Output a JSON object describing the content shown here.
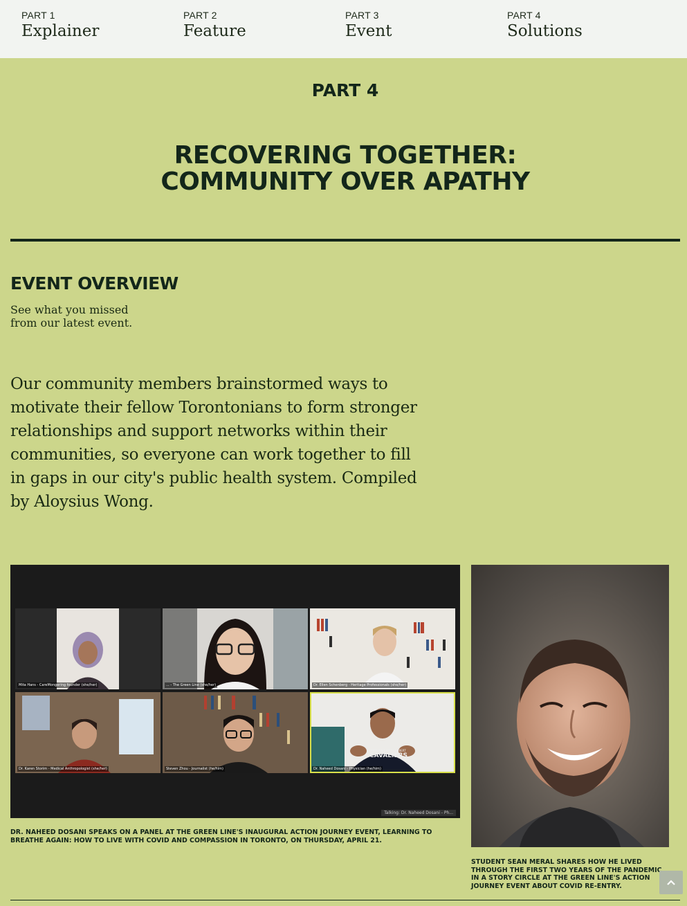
{
  "nav": {
    "items": [
      {
        "part": "PART 1",
        "title": "Explainer"
      },
      {
        "part": "PART 2",
        "title": "Feature"
      },
      {
        "part": "PART 3",
        "title": "Event"
      },
      {
        "part": "PART 4",
        "title": "Solutions"
      }
    ]
  },
  "section": {
    "part_label": "PART 4",
    "title_line1": "RECOVERING TOGETHER:",
    "title_line2": "COMMUNITY OVER APATHY"
  },
  "overview": {
    "heading": "EVENT OVERVIEW",
    "subtitle": "See what you missed from our latest event.",
    "body": "Our community members brainstormed ways to motivate their fellow Torontonians to form stronger relationships and support networks within their communities, so everyone can work together to fill in gaps in our city's public health system. Compiled by Aloysius Wong."
  },
  "photos": {
    "left": {
      "tiles": [
        "Mita Hans - CareMongering founder (she/her)",
        "... - The Green Line (she/her)",
        "Dr. Ellen Schenberg - Heritage Professionals (she/her)",
        "Dr. Karen Storim - Medical Anthropologist (she/her)",
        "Steven Zhou - Journalist (he/him)",
        "Dr. Naheed Dosani - Physician (he/him)"
      ],
      "talking": "Talking: Dr. Naheed Dosani - Ph...",
      "shirt_text_1": "CHAMPLAIN SAINT-LAMBERT",
      "shirt_text_2": "CAVALIERS",
      "caption": "DR. NAHEED DOSANI SPEAKS ON A PANEL AT THE GREEN LINE'S INAUGURAL ACTION JOURNEY EVENT, LEARNING TO BREATHE AGAIN: HOW TO LIVE WITH COVID AND COMPASSION IN TORONTO, ON THURSDAY, APRIL 21."
    },
    "right": {
      "caption": "STUDENT SEAN MERAL SHARES HOW HE LIVED THROUGH THE FIRST TWO YEARS OF THE PANDEMIC IN A STORY CIRCLE AT THE GREEN LINE'S ACTION JOURNEY EVENT ABOUT COVID RE-ENTRY."
    }
  },
  "colors": {
    "page_bg": "#ccd68b",
    "nav_bg": "#f2f4f1",
    "ink": "#13261a",
    "active_speaker": "#d9e04a"
  },
  "icons": {
    "scroll_top": "chevron-up-icon"
  }
}
